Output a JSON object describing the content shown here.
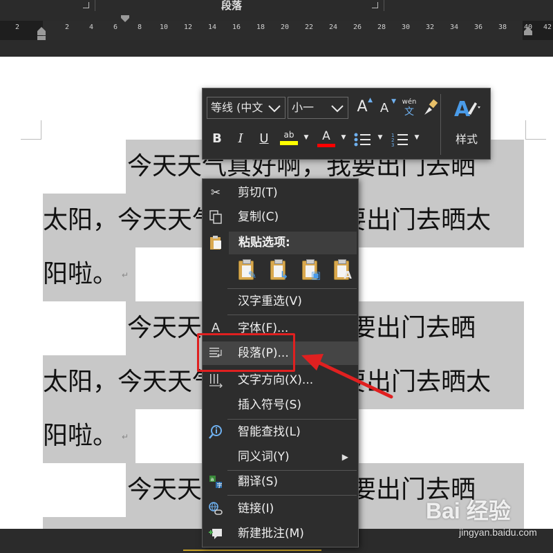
{
  "ribbon": {
    "group_label": "段落"
  },
  "ruler": {
    "ticks": [
      "2",
      "",
      "2",
      "4",
      "6",
      "8",
      "10",
      "12",
      "14",
      "16",
      "18",
      "20",
      "22",
      "24",
      "26",
      "28",
      "30",
      "32",
      "34",
      "36",
      "38",
      "40",
      "42"
    ]
  },
  "document": {
    "paragraph_text": "今天天气真好啊，我要出门去晒太阳，今天天气真好啊，我要出门去晒太阳啦。",
    "lines": [
      "今天天气真好啊，我要出门去晒",
      "太阳，今天天气真好啊，我要出门去晒太",
      "阳啦。",
      "今天天气真好啊，我要出门去晒",
      "太阳，今天天气真好啊，我要出门去晒太",
      "阳啦。",
      "今天天气真好啊，我要出门去晒"
    ]
  },
  "mini_toolbar": {
    "font_name": "等线 (中文",
    "font_size": "小一",
    "grow_font": "A",
    "shrink_font": "A",
    "phonetic_top": "wén",
    "phonetic_bottom": "文",
    "bold": "B",
    "italic": "I",
    "underline": "U",
    "highlight_glyph": "ab",
    "font_color_glyph": "A",
    "styles_label": "样式",
    "colors": {
      "highlight": "#ffff00",
      "font_color": "#ff0000",
      "accent": "#4a9be8"
    }
  },
  "context_menu": {
    "items": [
      {
        "label": "剪切(T)",
        "icon": "scissors-icon"
      },
      {
        "label": "复制(C)",
        "icon": "copy-icon"
      },
      {
        "label": "粘贴选项:",
        "icon": "paste-icon"
      },
      {
        "label": "汉字重选(V)",
        "icon": ""
      },
      {
        "label": "字体(F)...",
        "icon": "font-icon"
      },
      {
        "label": "段落(P)...",
        "icon": "paragraph-icon"
      },
      {
        "label": "文字方向(X)...",
        "icon": "text-direction-icon"
      },
      {
        "label": "插入符号(S)",
        "icon": ""
      },
      {
        "label": "智能查找(L)",
        "icon": "smart-lookup-icon"
      },
      {
        "label": "同义词(Y)",
        "icon": ""
      },
      {
        "label": "翻译(S)",
        "icon": "translate-icon"
      },
      {
        "label": "链接(I)",
        "icon": "link-icon"
      },
      {
        "label": "新建批注(M)",
        "icon": "new-comment-icon"
      }
    ],
    "paste_options": [
      "keep-source-formatting-icon",
      "merge-formatting-icon",
      "picture-icon",
      "keep-text-only-icon"
    ]
  },
  "annotation": {
    "highlight_color": "#e02020"
  },
  "watermark": {
    "logo": "Bai 经验",
    "url": "jingyan.baidu.com"
  }
}
